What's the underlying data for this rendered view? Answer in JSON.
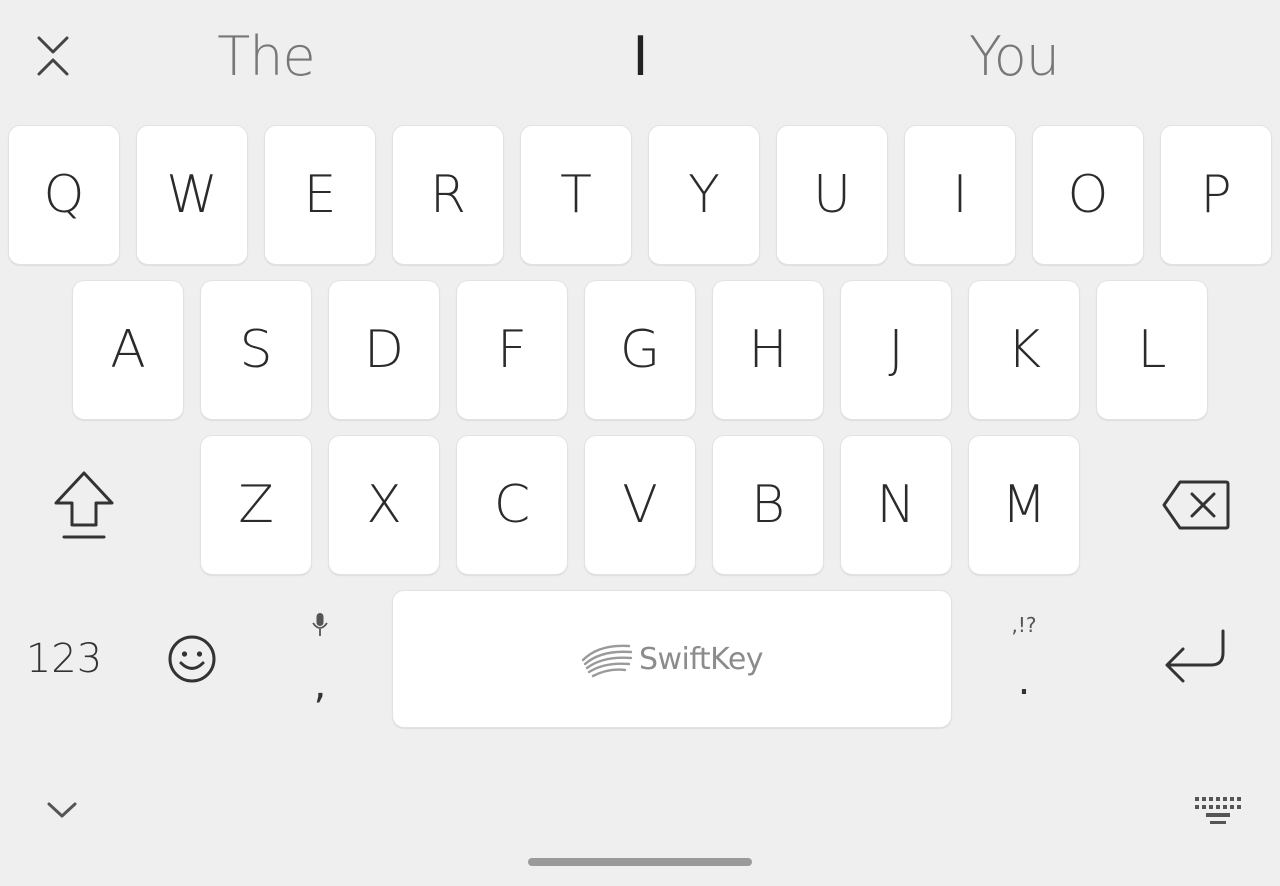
{
  "suggestions": {
    "left": "The",
    "center": "I",
    "right": "You"
  },
  "rows": {
    "row1": [
      "Q",
      "W",
      "E",
      "R",
      "T",
      "Y",
      "U",
      "I",
      "O",
      "P"
    ],
    "row2": [
      "A",
      "S",
      "D",
      "F",
      "G",
      "H",
      "J",
      "K",
      "L"
    ],
    "row3": [
      "Z",
      "X",
      "C",
      "V",
      "B",
      "N",
      "M"
    ]
  },
  "bottom": {
    "numbers_label": "123",
    "comma_label": ",",
    "period_label": ".",
    "punctuation_hint": ",!?",
    "space_brand": "SwiftKey"
  },
  "icons": {
    "collapse_toolbar": "collapse-arrows-icon",
    "shift": "shift-icon",
    "backspace": "backspace-icon",
    "emoji": "emoji-icon",
    "mic_hint": "microphone-icon",
    "enter": "enter-icon",
    "hide_keyboard": "chevron-down-icon",
    "keyboard_switch": "keyboard-icon",
    "brand_logo": "swiftkey-logo-icon"
  },
  "colors": {
    "background": "#efefef",
    "key": "#ffffff",
    "key_text": "#2b2b2b",
    "suggestion_text": "#777777",
    "brand_text": "#8c8c8c"
  }
}
